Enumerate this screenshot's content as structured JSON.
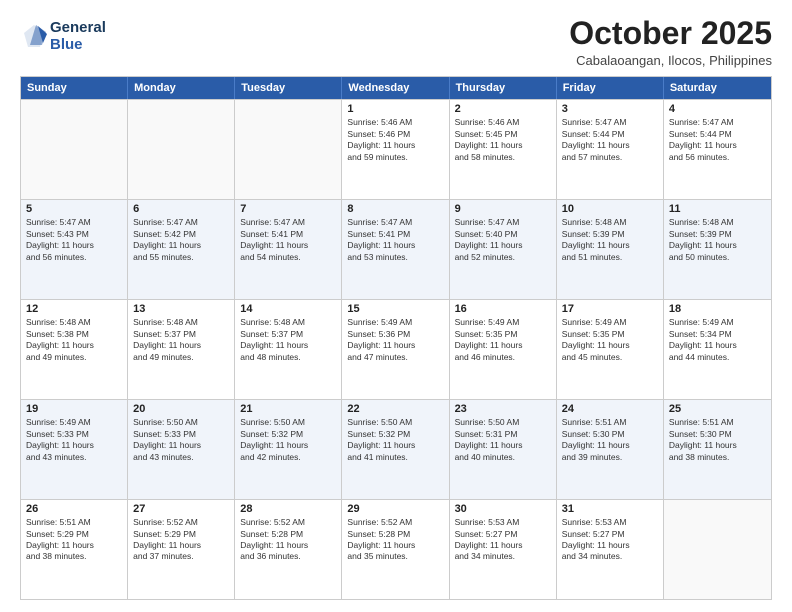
{
  "header": {
    "logo_line1": "General",
    "logo_line2": "Blue",
    "month": "October 2025",
    "location": "Cabalaoangan, Ilocos, Philippines"
  },
  "days_of_week": [
    "Sunday",
    "Monday",
    "Tuesday",
    "Wednesday",
    "Thursday",
    "Friday",
    "Saturday"
  ],
  "weeks": [
    [
      {
        "date": "",
        "info": ""
      },
      {
        "date": "",
        "info": ""
      },
      {
        "date": "",
        "info": ""
      },
      {
        "date": "1",
        "info": "Sunrise: 5:46 AM\nSunset: 5:46 PM\nDaylight: 11 hours\nand 59 minutes."
      },
      {
        "date": "2",
        "info": "Sunrise: 5:46 AM\nSunset: 5:45 PM\nDaylight: 11 hours\nand 58 minutes."
      },
      {
        "date": "3",
        "info": "Sunrise: 5:47 AM\nSunset: 5:44 PM\nDaylight: 11 hours\nand 57 minutes."
      },
      {
        "date": "4",
        "info": "Sunrise: 5:47 AM\nSunset: 5:44 PM\nDaylight: 11 hours\nand 56 minutes."
      }
    ],
    [
      {
        "date": "5",
        "info": "Sunrise: 5:47 AM\nSunset: 5:43 PM\nDaylight: 11 hours\nand 56 minutes."
      },
      {
        "date": "6",
        "info": "Sunrise: 5:47 AM\nSunset: 5:42 PM\nDaylight: 11 hours\nand 55 minutes."
      },
      {
        "date": "7",
        "info": "Sunrise: 5:47 AM\nSunset: 5:41 PM\nDaylight: 11 hours\nand 54 minutes."
      },
      {
        "date": "8",
        "info": "Sunrise: 5:47 AM\nSunset: 5:41 PM\nDaylight: 11 hours\nand 53 minutes."
      },
      {
        "date": "9",
        "info": "Sunrise: 5:47 AM\nSunset: 5:40 PM\nDaylight: 11 hours\nand 52 minutes."
      },
      {
        "date": "10",
        "info": "Sunrise: 5:48 AM\nSunset: 5:39 PM\nDaylight: 11 hours\nand 51 minutes."
      },
      {
        "date": "11",
        "info": "Sunrise: 5:48 AM\nSunset: 5:39 PM\nDaylight: 11 hours\nand 50 minutes."
      }
    ],
    [
      {
        "date": "12",
        "info": "Sunrise: 5:48 AM\nSunset: 5:38 PM\nDaylight: 11 hours\nand 49 minutes."
      },
      {
        "date": "13",
        "info": "Sunrise: 5:48 AM\nSunset: 5:37 PM\nDaylight: 11 hours\nand 49 minutes."
      },
      {
        "date": "14",
        "info": "Sunrise: 5:48 AM\nSunset: 5:37 PM\nDaylight: 11 hours\nand 48 minutes."
      },
      {
        "date": "15",
        "info": "Sunrise: 5:49 AM\nSunset: 5:36 PM\nDaylight: 11 hours\nand 47 minutes."
      },
      {
        "date": "16",
        "info": "Sunrise: 5:49 AM\nSunset: 5:35 PM\nDaylight: 11 hours\nand 46 minutes."
      },
      {
        "date": "17",
        "info": "Sunrise: 5:49 AM\nSunset: 5:35 PM\nDaylight: 11 hours\nand 45 minutes."
      },
      {
        "date": "18",
        "info": "Sunrise: 5:49 AM\nSunset: 5:34 PM\nDaylight: 11 hours\nand 44 minutes."
      }
    ],
    [
      {
        "date": "19",
        "info": "Sunrise: 5:49 AM\nSunset: 5:33 PM\nDaylight: 11 hours\nand 43 minutes."
      },
      {
        "date": "20",
        "info": "Sunrise: 5:50 AM\nSunset: 5:33 PM\nDaylight: 11 hours\nand 43 minutes."
      },
      {
        "date": "21",
        "info": "Sunrise: 5:50 AM\nSunset: 5:32 PM\nDaylight: 11 hours\nand 42 minutes."
      },
      {
        "date": "22",
        "info": "Sunrise: 5:50 AM\nSunset: 5:32 PM\nDaylight: 11 hours\nand 41 minutes."
      },
      {
        "date": "23",
        "info": "Sunrise: 5:50 AM\nSunset: 5:31 PM\nDaylight: 11 hours\nand 40 minutes."
      },
      {
        "date": "24",
        "info": "Sunrise: 5:51 AM\nSunset: 5:30 PM\nDaylight: 11 hours\nand 39 minutes."
      },
      {
        "date": "25",
        "info": "Sunrise: 5:51 AM\nSunset: 5:30 PM\nDaylight: 11 hours\nand 38 minutes."
      }
    ],
    [
      {
        "date": "26",
        "info": "Sunrise: 5:51 AM\nSunset: 5:29 PM\nDaylight: 11 hours\nand 38 minutes."
      },
      {
        "date": "27",
        "info": "Sunrise: 5:52 AM\nSunset: 5:29 PM\nDaylight: 11 hours\nand 37 minutes."
      },
      {
        "date": "28",
        "info": "Sunrise: 5:52 AM\nSunset: 5:28 PM\nDaylight: 11 hours\nand 36 minutes."
      },
      {
        "date": "29",
        "info": "Sunrise: 5:52 AM\nSunset: 5:28 PM\nDaylight: 11 hours\nand 35 minutes."
      },
      {
        "date": "30",
        "info": "Sunrise: 5:53 AM\nSunset: 5:27 PM\nDaylight: 11 hours\nand 34 minutes."
      },
      {
        "date": "31",
        "info": "Sunrise: 5:53 AM\nSunset: 5:27 PM\nDaylight: 11 hours\nand 34 minutes."
      },
      {
        "date": "",
        "info": ""
      }
    ]
  ]
}
